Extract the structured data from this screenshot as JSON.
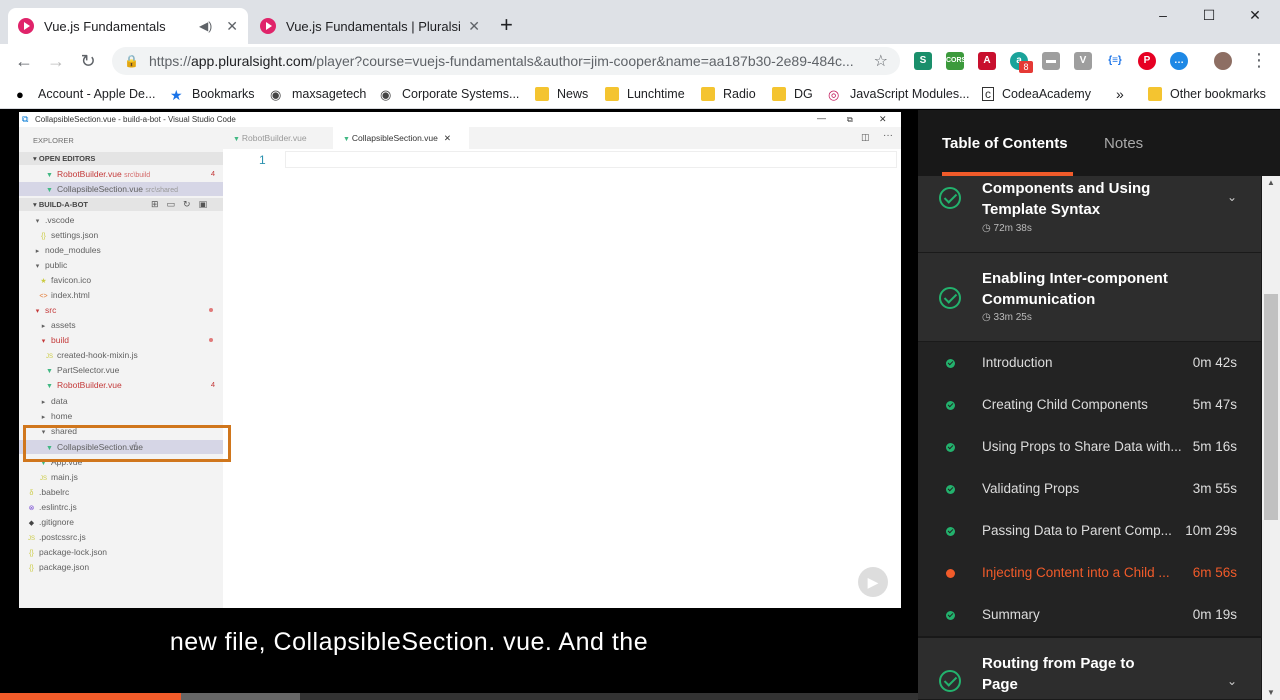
{
  "browser": {
    "tabs": [
      {
        "title": "Vue.js Fundamentals",
        "active": true
      },
      {
        "title": "Vue.js Fundamentals | Pluralsight",
        "active": false
      }
    ],
    "new_tab": "+",
    "window_controls": {
      "minimize": "–",
      "maximize": "☐",
      "close": "✕"
    },
    "url_prefix": "https://",
    "url_host": "app.pluralsight.com",
    "url_rest": "/player?course=vuejs-fundamentals&author=jim-cooper&name=aa187b30-2e89-484c...",
    "extension_badge": "8",
    "bookmarks": [
      {
        "label": "Account - Apple De...",
        "icon": "apple-icon"
      },
      {
        "label": "Bookmarks",
        "icon": "star-icon"
      },
      {
        "label": "maxsagetech",
        "icon": "globe-icon"
      },
      {
        "label": "Corporate Systems...",
        "icon": "globe-icon"
      },
      {
        "label": "News",
        "icon": "folder-icon"
      },
      {
        "label": "Lunchtime",
        "icon": "folder-icon"
      },
      {
        "label": "Radio",
        "icon": "folder-icon"
      },
      {
        "label": "DG",
        "icon": "folder-icon"
      },
      {
        "label": "JavaScript Modules...",
        "icon": "site-icon"
      },
      {
        "label": "CodeaAcademy",
        "icon": "site-icon"
      }
    ],
    "more_bookmarks": "»",
    "other_bookmarks": "Other bookmarks"
  },
  "vscode": {
    "title": "CollapsibleSection.vue - build-a-bot - Visual Studio Code",
    "explorer_label": "EXPLORER",
    "open_editors_label": "OPEN EDITORS",
    "open_editors": [
      {
        "name": "RobotBuilder.vue",
        "path": "src\\build",
        "badge": "4"
      },
      {
        "name": "CollapsibleSection.vue",
        "path": "src\\shared",
        "badge": ""
      }
    ],
    "project_label": "BUILD-A-BOT",
    "tree": [
      {
        "name": ".vscode",
        "icon": "▾"
      },
      {
        "name": "settings.json",
        "icon": "{}"
      },
      {
        "name": "node_modules",
        "icon": "▸"
      },
      {
        "name": "public",
        "icon": "▾"
      },
      {
        "name": "favicon.ico",
        "icon": "★"
      },
      {
        "name": "index.html",
        "icon": "<>"
      },
      {
        "name": "src",
        "icon": "▾"
      },
      {
        "name": "assets",
        "icon": "▸"
      },
      {
        "name": "build",
        "icon": "▾"
      },
      {
        "name": "created-hook-mixin.js",
        "icon": "JS"
      },
      {
        "name": "PartSelector.vue",
        "icon": "▼"
      },
      {
        "name": "RobotBuilder.vue",
        "icon": "▼"
      },
      {
        "name": "data",
        "icon": "▸"
      },
      {
        "name": "home",
        "icon": "▸"
      },
      {
        "name": "shared",
        "icon": "▾"
      },
      {
        "name": "CollapsibleSection.vue",
        "icon": "▼"
      },
      {
        "name": "App.vue",
        "icon": "▼"
      },
      {
        "name": "main.js",
        "icon": "JS"
      },
      {
        "name": ".babelrc",
        "icon": "δ"
      },
      {
        "name": ".eslintrc.js",
        "icon": "⊗"
      },
      {
        "name": ".gitignore",
        "icon": "◆"
      },
      {
        "name": ".postcssrc.js",
        "icon": "JS"
      },
      {
        "name": "package-lock.json",
        "icon": "{}"
      },
      {
        "name": "package.json",
        "icon": "{}"
      }
    ],
    "robotbuilder_badge": "4",
    "editor_tabs": [
      {
        "name": "RobotBuilder.vue",
        "active": false
      },
      {
        "name": "CollapsibleSection.vue",
        "active": true
      }
    ],
    "line_number": "1"
  },
  "caption": "new file, CollapsibleSection. vue. And the",
  "progress_fraction": 0.197,
  "toc": {
    "tab_contents": "Table of Contents",
    "tab_notes": "Notes",
    "modules": [
      {
        "title_line1": "Components and Using",
        "title_line2": "Template Syntax",
        "duration": "72m 38s"
      },
      {
        "title_line1": "Enabling Inter-component",
        "title_line2": "Communication",
        "duration": "33m 25s"
      },
      {
        "title_line1": "Routing from Page to",
        "title_line2": "Page",
        "duration": ""
      }
    ],
    "clips": [
      {
        "title": "Introduction",
        "duration": "0m 42s",
        "current": false
      },
      {
        "title": "Creating Child Components",
        "duration": "5m 47s",
        "current": false
      },
      {
        "title": "Using Props to Share Data with...",
        "duration": "5m 16s",
        "current": false
      },
      {
        "title": "Validating Props",
        "duration": "3m 55s",
        "current": false
      },
      {
        "title": "Passing Data to Parent Comp...",
        "duration": "10m 29s",
        "current": false
      },
      {
        "title": "Injecting Content into a Child ...",
        "duration": "6m 56s",
        "current": true
      },
      {
        "title": "Summary",
        "duration": "0m 19s",
        "current": false
      }
    ]
  },
  "colors": {
    "accent": "#f15b2a",
    "complete": "#23b26d",
    "highlight_box": "#d0761c"
  }
}
